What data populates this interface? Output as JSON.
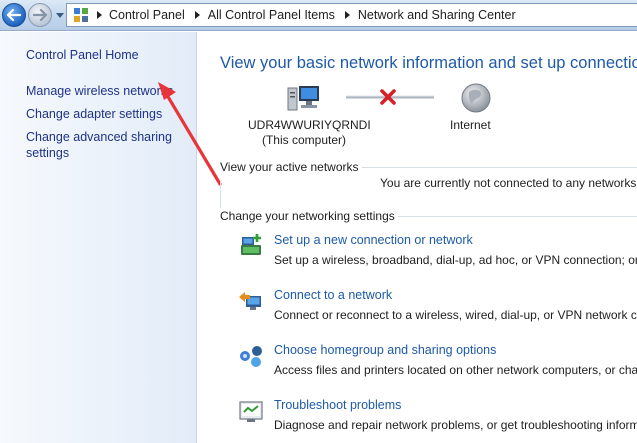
{
  "address_bar": {
    "crumbs": [
      "Control Panel",
      "All Control Panel Items",
      "Network and Sharing Center"
    ]
  },
  "left_pane": {
    "home": "Control Panel Home",
    "links": [
      "Manage wireless networks",
      "Change adapter settings",
      "Change advanced sharing settings"
    ]
  },
  "main": {
    "title": "View your basic network information and set up connections",
    "map": {
      "computer_name": "UDR4WWURIYQRNDI",
      "computer_sub": "(This computer)",
      "internet": "Internet"
    },
    "active_networks": {
      "heading": "View your active networks",
      "status": "You are currently not connected to any networks."
    },
    "settings": {
      "heading": "Change your networking settings",
      "tasks": [
        {
          "title": "Set up a new connection or network",
          "desc": "Set up a wireless, broadband, dial-up, ad hoc, or VPN connection; or set up a router or access point."
        },
        {
          "title": "Connect to a network",
          "desc": "Connect or reconnect to a wireless, wired, dial-up, or VPN network connection."
        },
        {
          "title": "Choose homegroup and sharing options",
          "desc": "Access files and printers located on other network computers, or change sharing settings."
        },
        {
          "title": "Troubleshoot problems",
          "desc": "Diagnose and repair network problems, or get troubleshooting information."
        }
      ]
    }
  },
  "colors": {
    "link": "#1e5aa8",
    "title": "#1e5aa8",
    "annotation_arrow": "#e8353a",
    "fail_x": "#d8202a"
  },
  "icons": [
    "back-arrow-icon",
    "forward-arrow-icon",
    "control-panel-icon",
    "computer-icon",
    "internet-globe-icon",
    "red-x-icon",
    "new-connection-icon",
    "connect-network-icon",
    "homegroup-icon",
    "troubleshoot-icon"
  ]
}
